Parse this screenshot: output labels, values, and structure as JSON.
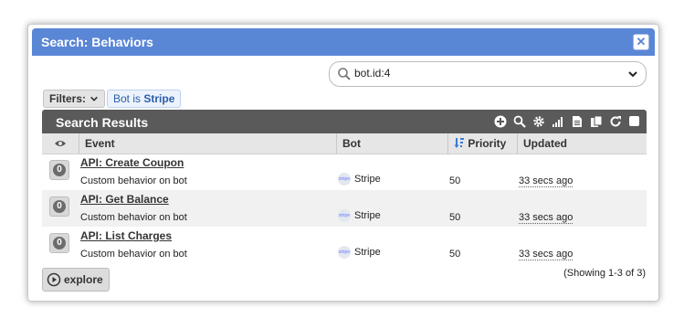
{
  "dialog": {
    "title": "Search: Behaviors",
    "close_label": "✕"
  },
  "search": {
    "value": "bot.id:4",
    "placeholder": ""
  },
  "filters": {
    "button_label": "Filters:",
    "chip_prefix": "Bot is",
    "chip_value": "Stripe"
  },
  "results": {
    "title": "Search Results",
    "toolbar_icons": [
      "add-icon",
      "search-icon",
      "gear-icon",
      "bar-chart-icon",
      "document-icon",
      "copy-icon",
      "refresh-icon",
      "checkbox-icon"
    ],
    "columns": {
      "event": "Event",
      "bot": "Bot",
      "priority": "Priority",
      "updated": "Updated"
    },
    "rows": [
      {
        "badge": "0",
        "event": "API: Create Coupon",
        "desc": "Custom behavior on bot",
        "bot_logo": "stripe",
        "bot": "Stripe",
        "priority": "50",
        "updated": "33 secs ago"
      },
      {
        "badge": "0",
        "event": "API: Get Balance",
        "desc": "Custom behavior on bot",
        "bot_logo": "stripe",
        "bot": "Stripe",
        "priority": "50",
        "updated": "33 secs ago"
      },
      {
        "badge": "0",
        "event": "API: List Charges",
        "desc": "Custom behavior on bot",
        "bot_logo": "stripe",
        "bot": "Stripe",
        "priority": "50",
        "updated": "33 secs ago"
      }
    ]
  },
  "footer": {
    "explore_label": "explore",
    "showing": "(Showing 1-3 of 3)"
  },
  "colors": {
    "titlebar": "#5a86d6",
    "results_header": "#5a5a5a",
    "chip_text": "#2a5ea8"
  }
}
